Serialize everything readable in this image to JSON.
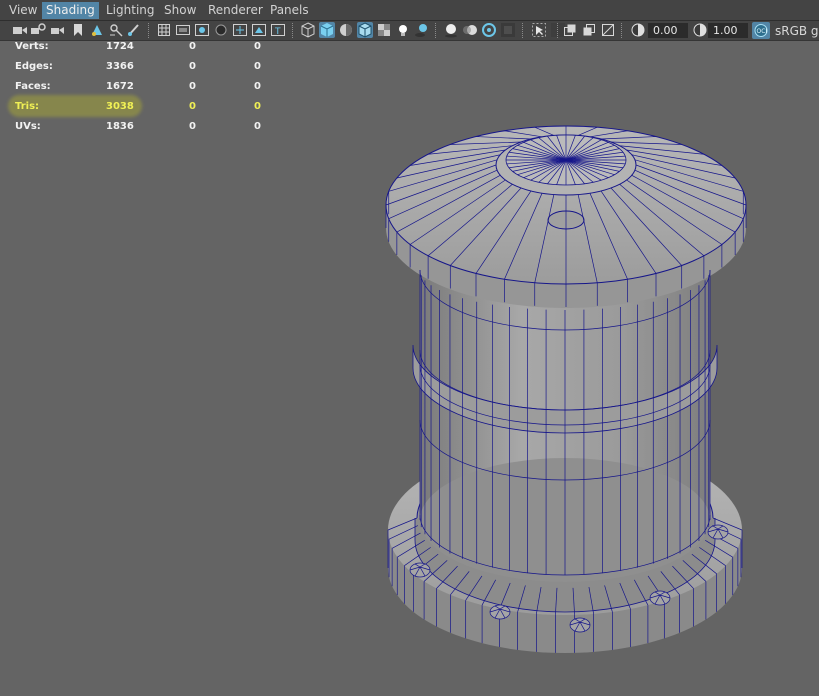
{
  "menu": {
    "items": [
      {
        "label": "View",
        "active": false
      },
      {
        "label": "Shading",
        "active": true
      },
      {
        "label": "Lighting",
        "active": false
      },
      {
        "label": "Show",
        "active": false
      },
      {
        "label": "Renderer",
        "active": false
      },
      {
        "label": "Panels",
        "active": false
      }
    ]
  },
  "toolbar": {
    "exposure_value": "0.00",
    "gamma_value": "1.00",
    "colorspace_label": "sRGB ga",
    "icons": [
      "camera-select-icon",
      "camera-attributes-icon",
      "bookmark-icon",
      "image-plane-icon",
      "grid-icon",
      "film-gate-icon",
      "resolution-gate-icon",
      "gate-mask-icon",
      "field-chart-icon",
      "safe-action-icon",
      "safe-title-icon",
      "wireframe-icon",
      "smooth-shade-icon",
      "default-material-icon",
      "wireframe-on-shaded-icon",
      "textured-icon",
      "use-all-lights-icon",
      "shadows-icon",
      "screen-space-ao-icon",
      "motion-blur-icon",
      "multisample-aa-icon",
      "depth-of-field-icon",
      "isolate-select-icon",
      "xray-icon",
      "xray-joints-icon",
      "xray-active-icon",
      "backface-culling-icon",
      "exposure-icon",
      "gamma-icon",
      "color-management-icon"
    ],
    "accent_color": "#5285a6"
  },
  "hud": {
    "rows": [
      {
        "label": "Verts:",
        "value": "1724",
        "col2": "0",
        "col3": "0",
        "highlight": false
      },
      {
        "label": "Edges:",
        "value": "3366",
        "col2": "0",
        "col3": "0",
        "highlight": false
      },
      {
        "label": "Faces:",
        "value": "1672",
        "col2": "0",
        "col3": "0",
        "highlight": false
      },
      {
        "label": "Tris:",
        "value": "3038",
        "col2": "0",
        "col3": "0",
        "highlight": true
      },
      {
        "label": "UVs:",
        "value": "1836",
        "col2": "0",
        "col3": "0",
        "highlight": false
      }
    ],
    "highlight_color": "#f0f055"
  },
  "viewport": {
    "background_color": "#646464",
    "wire_color": "#16168a"
  }
}
